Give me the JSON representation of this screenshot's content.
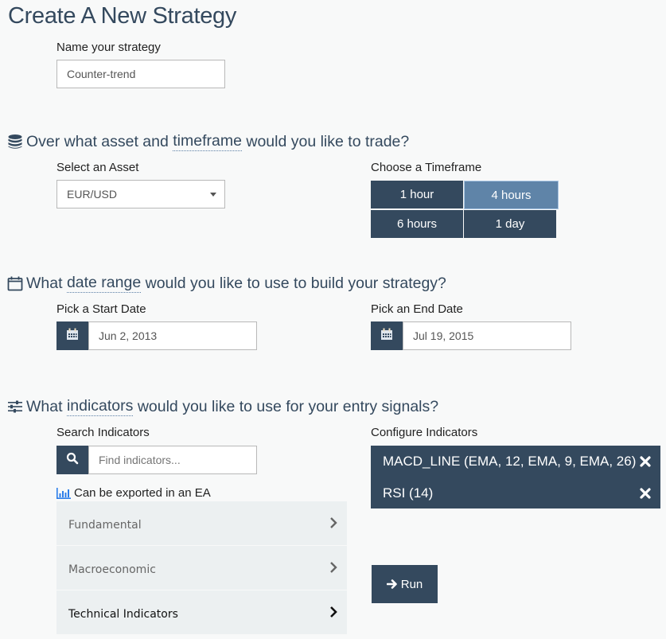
{
  "page": {
    "title": "Create A New Strategy"
  },
  "name_section": {
    "label": "Name your strategy",
    "value": "Counter-trend"
  },
  "asset_section": {
    "heading_before": "Over what asset and ",
    "heading_link": "timeframe",
    "heading_after": " would you like to trade?",
    "heading_icon": "database-icon",
    "asset_label": "Select an Asset",
    "asset_value": "EUR/USD",
    "timeframe_label": "Choose a Timeframe",
    "timeframes": [
      {
        "label": "1 hour",
        "selected": false
      },
      {
        "label": "4 hours",
        "selected": true
      },
      {
        "label": "6 hours",
        "selected": false
      },
      {
        "label": "1 day",
        "selected": false
      }
    ]
  },
  "date_section": {
    "heading_before": "What ",
    "heading_link": "date range",
    "heading_after": " would you like to use to build your strategy?",
    "heading_icon": "calendar-outline-icon",
    "start_label": "Pick a Start Date",
    "start_value": "Jun 2, 2013",
    "end_label": "Pick an End Date",
    "end_value": "Jul 19, 2015"
  },
  "indicators_section": {
    "heading_before": "What ",
    "heading_link": "indicators",
    "heading_after": " would you like to use for your entry signals?",
    "heading_icon": "sliders-icon",
    "search_label": "Search Indicators",
    "search_placeholder": "Find indicators...",
    "export_note": "Can be exported in an EA",
    "categories": [
      {
        "label": "Fundamental"
      },
      {
        "label": "Macroeconomic"
      },
      {
        "label": "Technical Indicators"
      }
    ],
    "configure_label": "Configure Indicators",
    "configured": [
      {
        "label": "MACD_LINE (EMA, 12, EMA, 9, EMA, 26)"
      },
      {
        "label": "RSI (14)"
      }
    ],
    "run_label": "Run"
  },
  "colors": {
    "primary": "#34495e",
    "selected": "#5f84a8",
    "background": "#f8f9f9",
    "list_background": "#ecf0f1",
    "export_icon": "#2b7de9"
  }
}
